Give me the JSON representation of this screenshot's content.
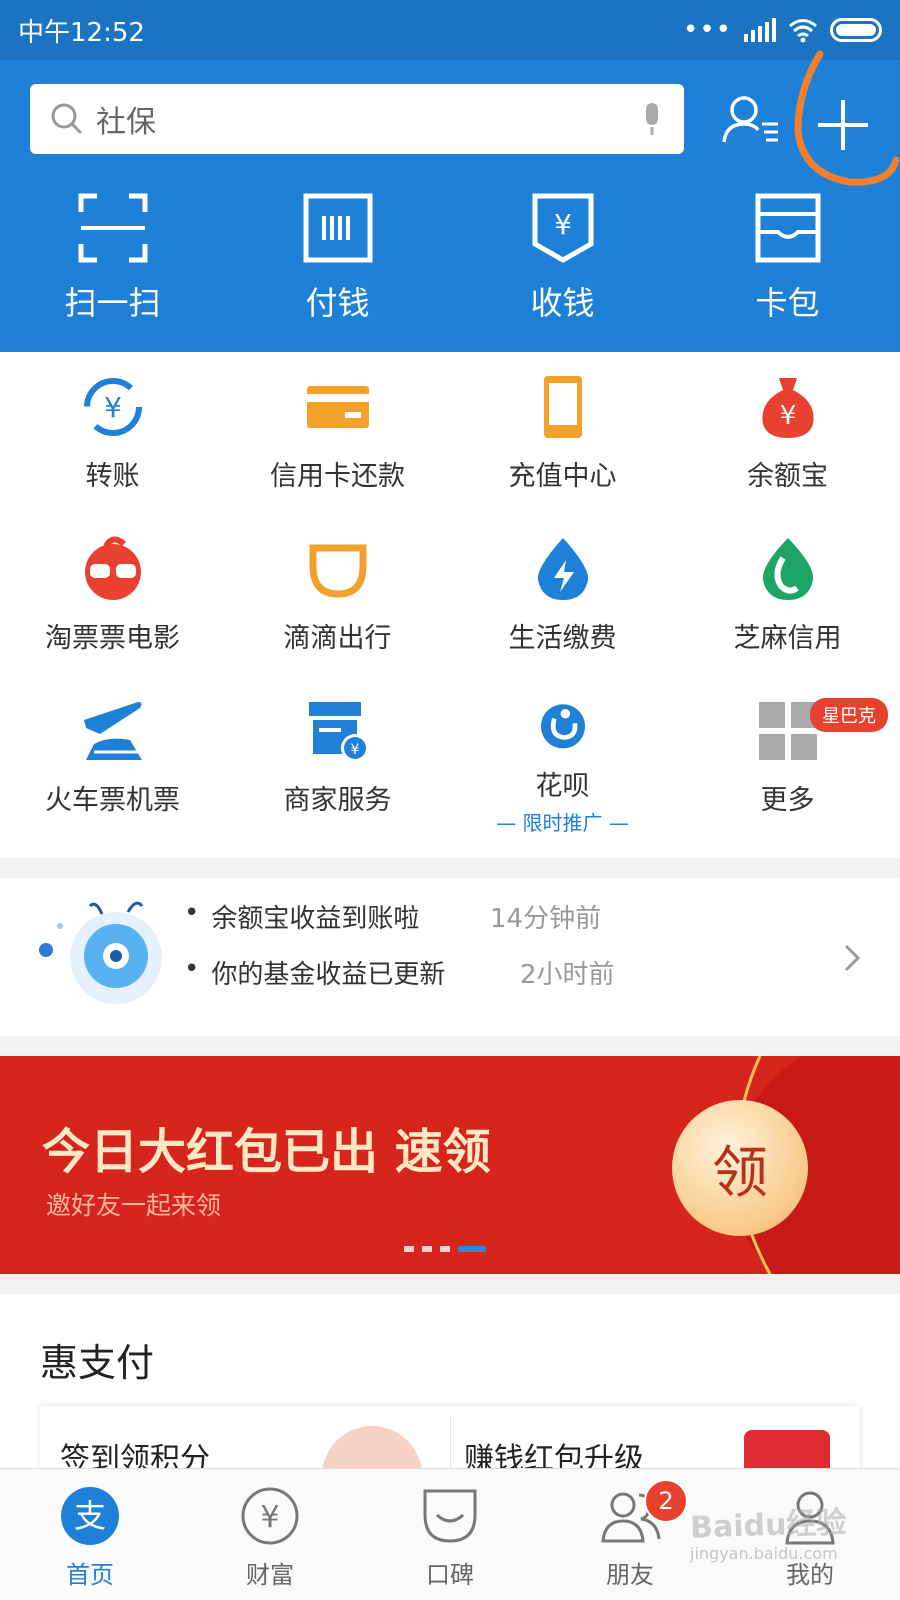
{
  "status_bar": {
    "time": "中午12:52",
    "dots": "•••"
  },
  "search": {
    "placeholder": "社保"
  },
  "quick_actions": [
    {
      "label": "扫一扫",
      "icon": "scan-icon"
    },
    {
      "label": "付钱",
      "icon": "pay-barcode-icon"
    },
    {
      "label": "收钱",
      "icon": "receive-money-icon"
    },
    {
      "label": "卡包",
      "icon": "card-wallet-icon"
    }
  ],
  "grid": [
    {
      "label": "转账",
      "icon": "transfer-icon",
      "color": "#1f80d7"
    },
    {
      "label": "信用卡还款",
      "icon": "credit-card-icon",
      "color": "#f3a12a"
    },
    {
      "label": "充值中心",
      "icon": "phone-recharge-icon",
      "color": "#f3a12a"
    },
    {
      "label": "余额宝",
      "icon": "money-bag-icon",
      "color": "#e8412f"
    },
    {
      "label": "淘票票电影",
      "icon": "glasses-icon",
      "color": "#e8412f"
    },
    {
      "label": "滴滴出行",
      "icon": "didi-icon",
      "color": "#f3a12a"
    },
    {
      "label": "生活缴费",
      "icon": "lightning-drop-icon",
      "color": "#1f80d7"
    },
    {
      "label": "芝麻信用",
      "icon": "sesame-icon",
      "color": "#1ea566"
    },
    {
      "label": "火车票机票",
      "icon": "plane-train-icon",
      "color": "#1f80d7"
    },
    {
      "label": "商家服务",
      "icon": "store-icon",
      "color": "#1f80d7"
    },
    {
      "label": "花呗",
      "icon": "huabei-icon",
      "color": "#1f80d7",
      "sub": "— 限时推广 —"
    },
    {
      "label": "更多",
      "icon": "more-grid-icon",
      "color": "#aaaaaa"
    }
  ],
  "more_badge": "星巴克",
  "notices": [
    {
      "text": "余额宝收益到账啦",
      "time": "14分钟前"
    },
    {
      "text": "你的基金收益已更新",
      "time": "2小时前"
    }
  ],
  "banner": {
    "title": "今日大红包已出 速领",
    "subtitle": "邀好友一起来领",
    "coin": "领",
    "page_count": 4,
    "active_page": 4
  },
  "section": {
    "title": "惠支付",
    "promos": [
      "签到领积分",
      "赚钱红包升级"
    ]
  },
  "tabs": [
    {
      "label": "首页",
      "icon": "alipay-home-icon",
      "active": true
    },
    {
      "label": "财富",
      "icon": "wealth-icon",
      "active": false
    },
    {
      "label": "口碑",
      "icon": "koubei-icon",
      "active": false
    },
    {
      "label": "朋友",
      "icon": "friends-icon",
      "active": false,
      "badge": "2"
    },
    {
      "label": "我的",
      "icon": "profile-icon",
      "active": false
    }
  ],
  "watermark": {
    "main": "Baidu经验",
    "sub": "jingyan.baidu.com"
  },
  "colors": {
    "header_blue": "#1f80d7",
    "status_blue": "#1b73c2",
    "banner_red": "#d6251d",
    "badge_red": "#e8412f"
  }
}
